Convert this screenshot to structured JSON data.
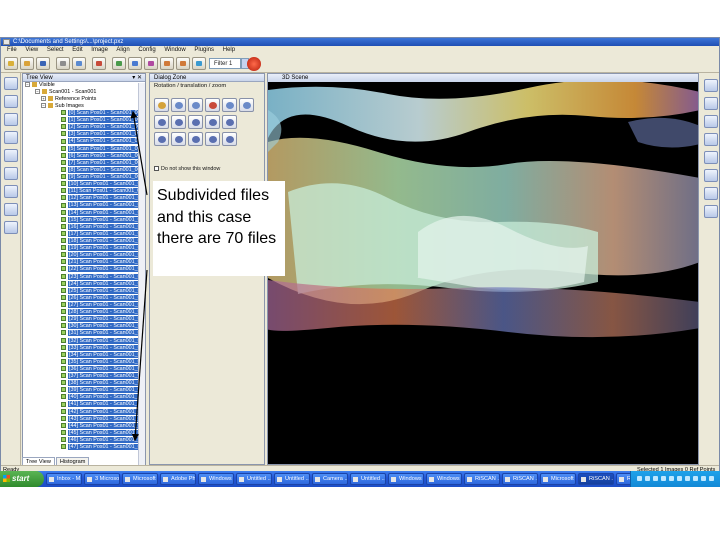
{
  "window": {
    "title": "C:\\Documents and Settings\\...\\project.pxz"
  },
  "menu": [
    "File",
    "View",
    "Select",
    "Edit",
    "Image",
    "Align",
    "Config",
    "Window",
    "Plugins",
    "Help"
  ],
  "toolbar": {
    "filter_value": "Filter 1"
  },
  "tree_view": {
    "title": "Tree View",
    "root": "Visible",
    "nodes": [
      "Scan001 - Scan001",
      "Reference Points",
      "Sub Images"
    ],
    "rows": [
      "[0] Scan Pos01 - Scan001_00000",
      "[1] Scan Pos01 - Scan001_00001",
      "[2] Scan Pos01 - Scan001_00002",
      "[3] Scan Pos01 - Scan001_00003",
      "[4] Scan Pos01 - Scan001_00004",
      "[5] Scan Pos01 - Scan001_00005",
      "[6] Scan Pos01 - Scan001_00006",
      "[7] Scan Pos01 - Scan001_00007",
      "[8] Scan Pos01 - Scan001_00008",
      "[9] Scan Pos01 - Scan001_00009",
      "[10] Scan Pos01 - Scan001_00010",
      "[11] Scan Pos01 - Scan001_00011",
      "[12] Scan Pos01 - Scan001_00012",
      "[13] Scan Pos01 - Scan001_00013",
      "[14] Scan Pos01 - Scan001_00014",
      "[15] Scan Pos01 - Scan001_00015",
      "[16] Scan Pos01 - Scan001_00016",
      "[17] Scan Pos01 - Scan001_00017",
      "[18] Scan Pos01 - Scan001_00018",
      "[19] Scan Pos01 - Scan001_00019",
      "[20] Scan Pos01 - Scan001_00020",
      "[21] Scan Pos01 - Scan001_00021",
      "[22] Scan Pos01 - Scan001_00022",
      "[23] Scan Pos01 - Scan001_00023",
      "[24] Scan Pos01 - Scan001_00024",
      "[25] Scan Pos01 - Scan001_00025",
      "[26] Scan Pos01 - Scan001_00026",
      "[27] Scan Pos01 - Scan001_00027",
      "[28] Scan Pos01 - Scan001_00028",
      "[29] Scan Pos01 - Scan001_00029",
      "[30] Scan Pos01 - Scan001_00030",
      "[31] Scan Pos01 - Scan001_00031",
      "[32] Scan Pos01 - Scan001_00032",
      "[33] Scan Pos01 - Scan001_00033",
      "[34] Scan Pos01 - Scan001_00034",
      "[35] Scan Pos01 - Scan001_00035",
      "[36] Scan Pos01 - Scan001_00036",
      "[37] Scan Pos01 - Scan001_00037",
      "[38] Scan Pos01 - Scan001_00038",
      "[39] Scan Pos01 - Scan001_00039",
      "[40] Scan Pos01 - Scan001_00040",
      "[41] Scan Pos01 - Scan001_00041",
      "[42] Scan Pos01 - Scan001_00042",
      "[43] Scan Pos01 - Scan001_00043",
      "[44] Scan Pos01 - Scan001_00044",
      "[45] Scan Pos01 - Scan001_00045",
      "[46] Scan Pos01 - Scan001_00046",
      "[47] Scan Pos01 - Scan001_00047"
    ],
    "tabs": [
      "Tree View",
      "Histogram"
    ]
  },
  "dialog_zone": {
    "title": "Dialog Zone",
    "subtitle": "Rotation / translation / zoom",
    "dont_show": "Do not show this window"
  },
  "scene": {
    "title": "3D Scene"
  },
  "status": {
    "left": "Ready",
    "right": "Selected 1 Images 0 Ref Points"
  },
  "taskbar": {
    "start": "start",
    "tasks": [
      "Inbox - M...",
      "3 Microsoft ...",
      "Microsoft ...",
      "Adobe Pho...",
      "Windows ...",
      "Untitled ...",
      "Untitled ...",
      "Camera ...",
      "Untitled ...",
      "Windows ...",
      "Windows ...",
      "RiSCAN ...",
      "RiSCAN ...",
      "Microsoft ...",
      "RiSCAN ...",
      "RiSCAN ..."
    ],
    "active_index": 14
  },
  "annotation": {
    "text": "Subdivided files and this case there are 70 files"
  },
  "colors": {
    "selection": "#316ac5",
    "taskbar": "#245edb",
    "start": "#3c9a37",
    "scene_background": "#000000"
  }
}
